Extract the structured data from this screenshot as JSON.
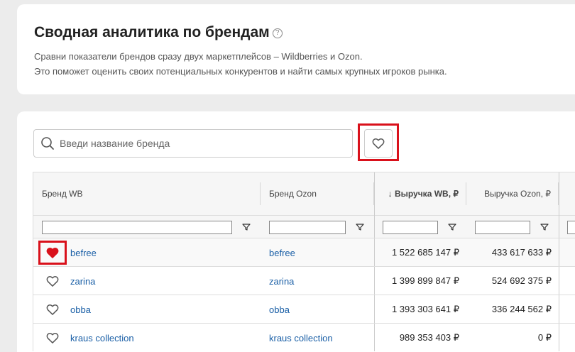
{
  "header": {
    "title": "Сводная аналитика по брендам",
    "help_icon": "?",
    "desc_line1": "Сравни показатели брендов сразу двух маркетплейсов – Wildberries и Ozon.",
    "desc_line2": "Это поможет оценить своих потенциальных конкурентов и найти самых крупных игроков рынка."
  },
  "search": {
    "placeholder": "Введи название бренда",
    "value": ""
  },
  "colors": {
    "accent_red": "#d9111b",
    "link": "#1a5fa6"
  },
  "table": {
    "columns": [
      {
        "label": "Бренд WB"
      },
      {
        "label": "Бренд Ozon"
      },
      {
        "label": "↓ Выручка WB, ₽"
      },
      {
        "label": "Выручка Ozon, ₽"
      }
    ],
    "rows": [
      {
        "favorite": true,
        "brand_wb": "befree",
        "brand_ozon": "befree",
        "revenue_wb": "1 522 685 147 ₽",
        "revenue_ozon": "433 617 633 ₽"
      },
      {
        "favorite": false,
        "brand_wb": "zarina",
        "brand_ozon": "zarina",
        "revenue_wb": "1 399 899 847 ₽",
        "revenue_ozon": "524 692 375 ₽"
      },
      {
        "favorite": false,
        "brand_wb": "obba",
        "brand_ozon": "obba",
        "revenue_wb": "1 393 303 641 ₽",
        "revenue_ozon": "336 244 562 ₽"
      },
      {
        "favorite": false,
        "brand_wb": "kraus collection",
        "brand_ozon": "kraus collection",
        "revenue_wb": "989 353 403 ₽",
        "revenue_ozon": "0 ₽"
      }
    ]
  }
}
